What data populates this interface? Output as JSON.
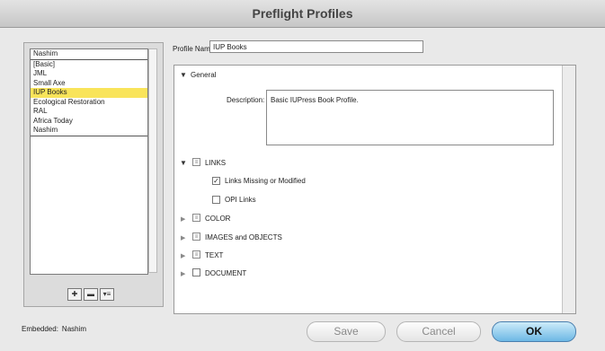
{
  "window": {
    "title": "Preflight Profiles"
  },
  "profile_list": {
    "items": [
      "Nashim",
      "[Basic]",
      "JML",
      "Small Axe",
      "IUP Books",
      "Ecological Restoration",
      "RAL",
      "Africa Today",
      "Nashim"
    ],
    "selected_index": 4,
    "buttons": [
      {
        "icon": "new-profile-icon",
        "glyph": "✚"
      },
      {
        "icon": "delete-profile-icon",
        "glyph": "▬"
      },
      {
        "icon": "profile-menu-icon",
        "glyph": "▾≡"
      }
    ]
  },
  "embedded": {
    "label": "Embedded:",
    "value": "Nashim"
  },
  "profile_name": {
    "label": "Profile Name:",
    "value": "IUP Books"
  },
  "general": {
    "label": "General",
    "description_label": "Description:",
    "description": "Basic IUPress Book Profile."
  },
  "rules": {
    "links": {
      "label": "LINKS",
      "items": [
        {
          "label": "Links Missing or Modified",
          "checked": true
        },
        {
          "label": "OPI Links",
          "checked": false
        }
      ]
    },
    "categories": [
      "COLOR",
      "IMAGES and OBJECTS",
      "TEXT",
      "DOCUMENT"
    ]
  },
  "footer": {
    "save": "Save",
    "cancel": "Cancel",
    "ok": "OK"
  }
}
